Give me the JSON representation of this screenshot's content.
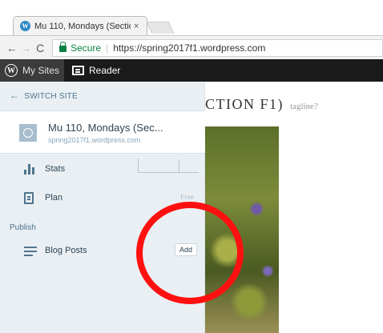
{
  "browser": {
    "tab_title": "Mu 110, Mondays (Sectio",
    "tab_close": "×",
    "nav_back": "←",
    "nav_forward": "→",
    "nav_reload": "C",
    "secure_label": "Secure",
    "url": "https://spring2017f1.wordpress.com"
  },
  "masterbar": {
    "my_sites_label": "My Sites",
    "reader_label": "Reader"
  },
  "sidebar": {
    "switch_site_label": "SWITCH SITE",
    "site": {
      "name": "Mu 110, Mondays (Sec...",
      "url": "spring2017f1.wordpress.com"
    },
    "stats_label": "Stats",
    "plan_label": "Plan",
    "plan_badge": "Free",
    "publish_header": "Publish",
    "blog_posts_label": "Blog Posts",
    "add_button_label": "Add"
  },
  "preview": {
    "site_title": "CTION F1)",
    "tagline": "tagline?"
  },
  "annotation": {
    "ring_color": "#ff1010"
  }
}
